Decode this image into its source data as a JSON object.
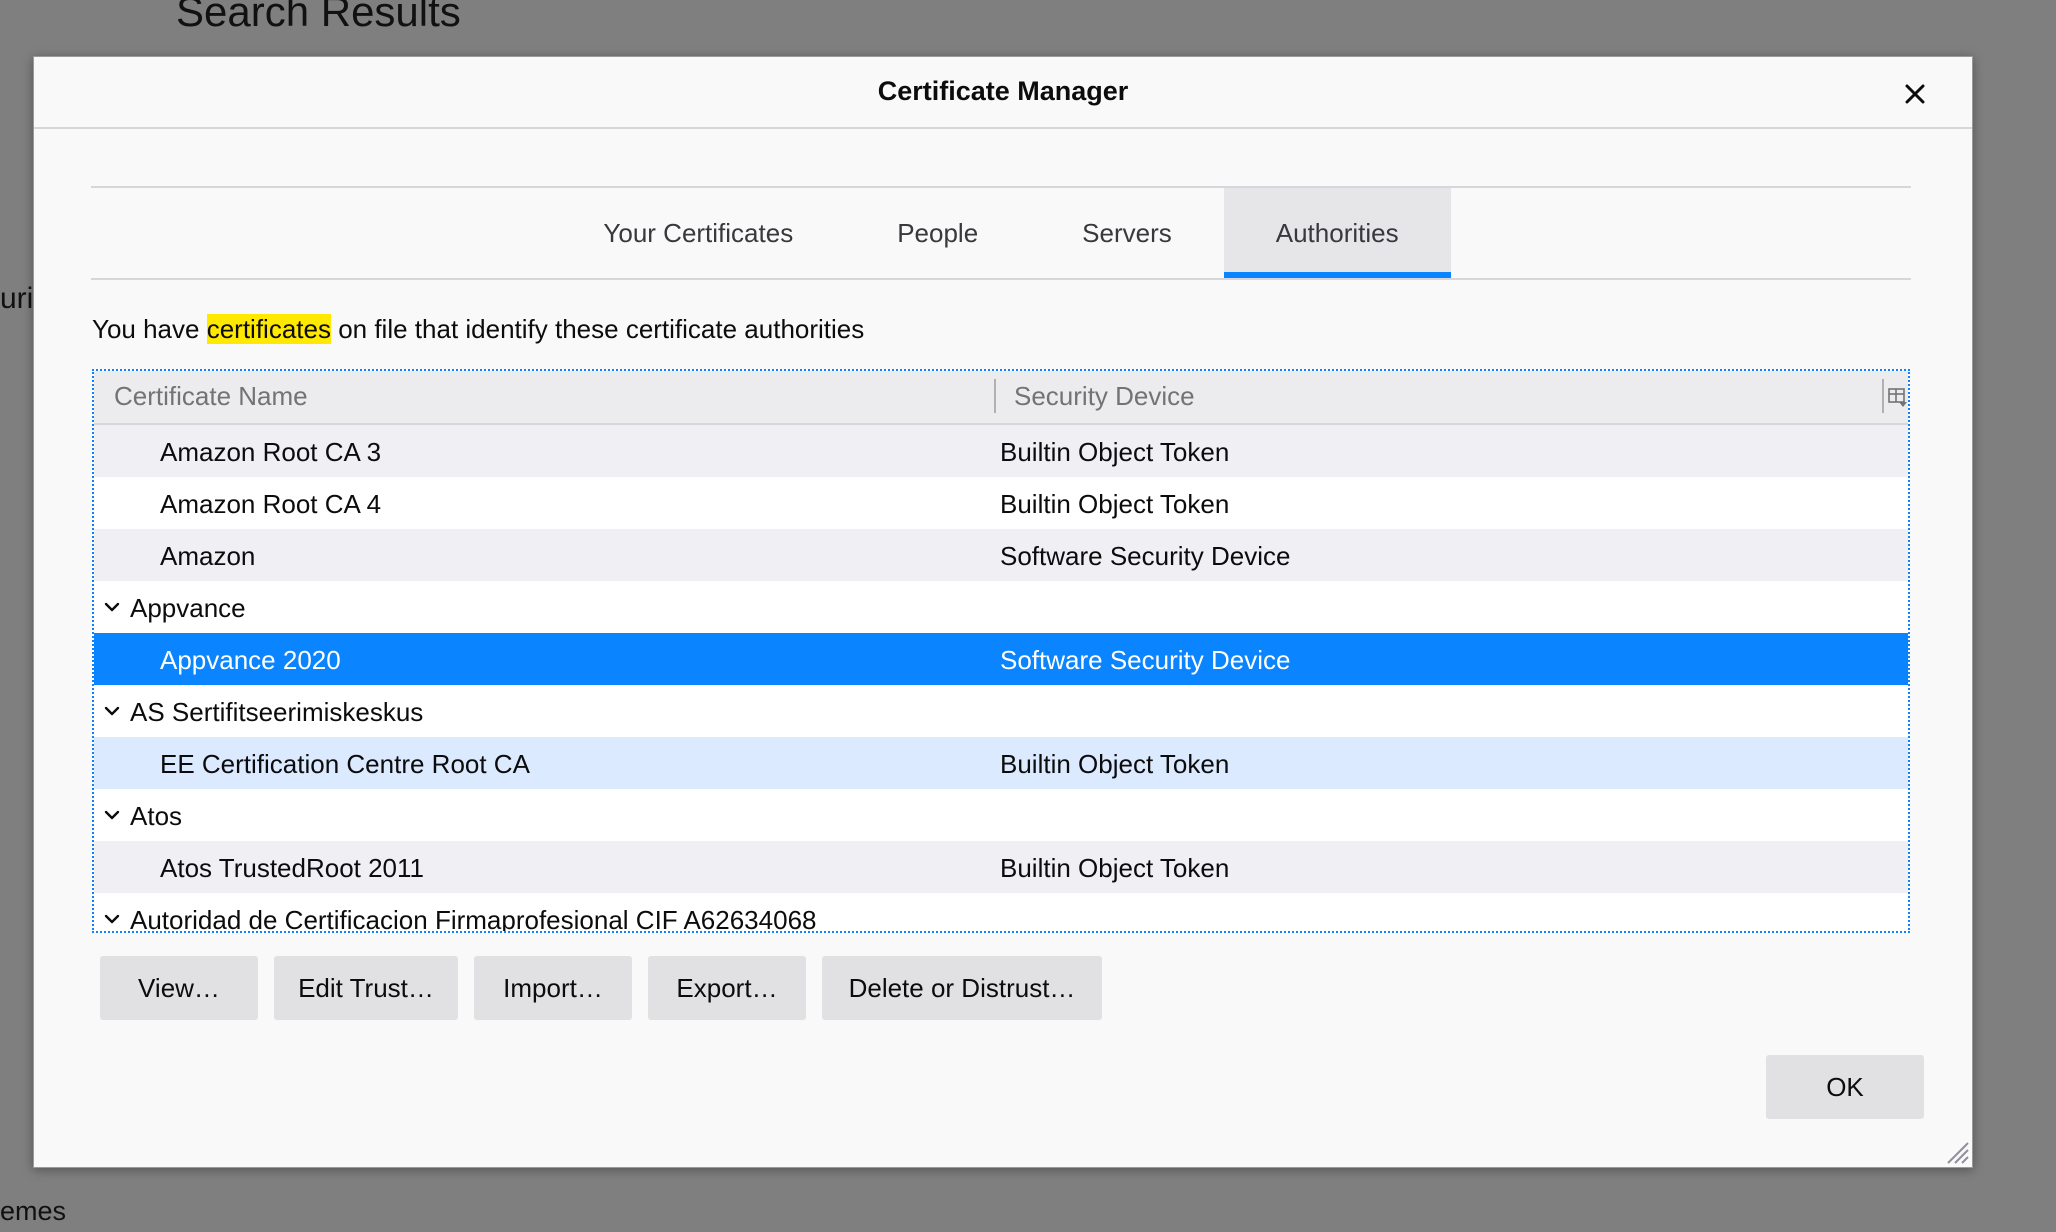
{
  "background": {
    "title": "Search Results",
    "fragment_left": "uri",
    "fragment_bottom": "emes"
  },
  "dialog": {
    "title": "Certificate Manager",
    "close_icon": "close-icon"
  },
  "tabs": [
    {
      "label": "Your Certificates",
      "selected": false
    },
    {
      "label": "People",
      "selected": false
    },
    {
      "label": "Servers",
      "selected": false
    },
    {
      "label": "Authorities",
      "selected": true
    }
  ],
  "description": {
    "before": "You have ",
    "highlight": "certificates",
    "after": " on file that identify these certificate authorities"
  },
  "table": {
    "columns": [
      "Certificate Name",
      "Security Device"
    ],
    "column_picker_icon": "column-picker-icon",
    "rows": [
      {
        "name": "Amazon Root CA 3",
        "device": "Builtin Object Token"
      },
      {
        "name": "Amazon Root CA 4",
        "device": "Builtin Object Token"
      },
      {
        "name": "Amazon",
        "device": "Software Security Device"
      },
      {
        "name": "Appvance",
        "device": ""
      },
      {
        "name": "Appvance 2020",
        "device": "Software Security Device"
      },
      {
        "name": "AS Sertifitseerimiskeskus",
        "device": ""
      },
      {
        "name": "EE Certification Centre Root CA",
        "device": "Builtin Object Token"
      },
      {
        "name": "Atos",
        "device": ""
      },
      {
        "name": "Atos TrustedRoot 2011",
        "device": "Builtin Object Token"
      },
      {
        "name": "Autoridad de Certificacion Firmaprofesional CIF A62634068",
        "device": ""
      }
    ]
  },
  "buttons": {
    "view": "View…",
    "edit_trust": "Edit Trust…",
    "import": "Import…",
    "export": "Export…",
    "delete_distrust": "Delete or Distrust…",
    "ok": "OK"
  },
  "colors": {
    "accent": "#0a84ff",
    "highlight": "#ffe900",
    "overlay": "#7f7f7f"
  }
}
